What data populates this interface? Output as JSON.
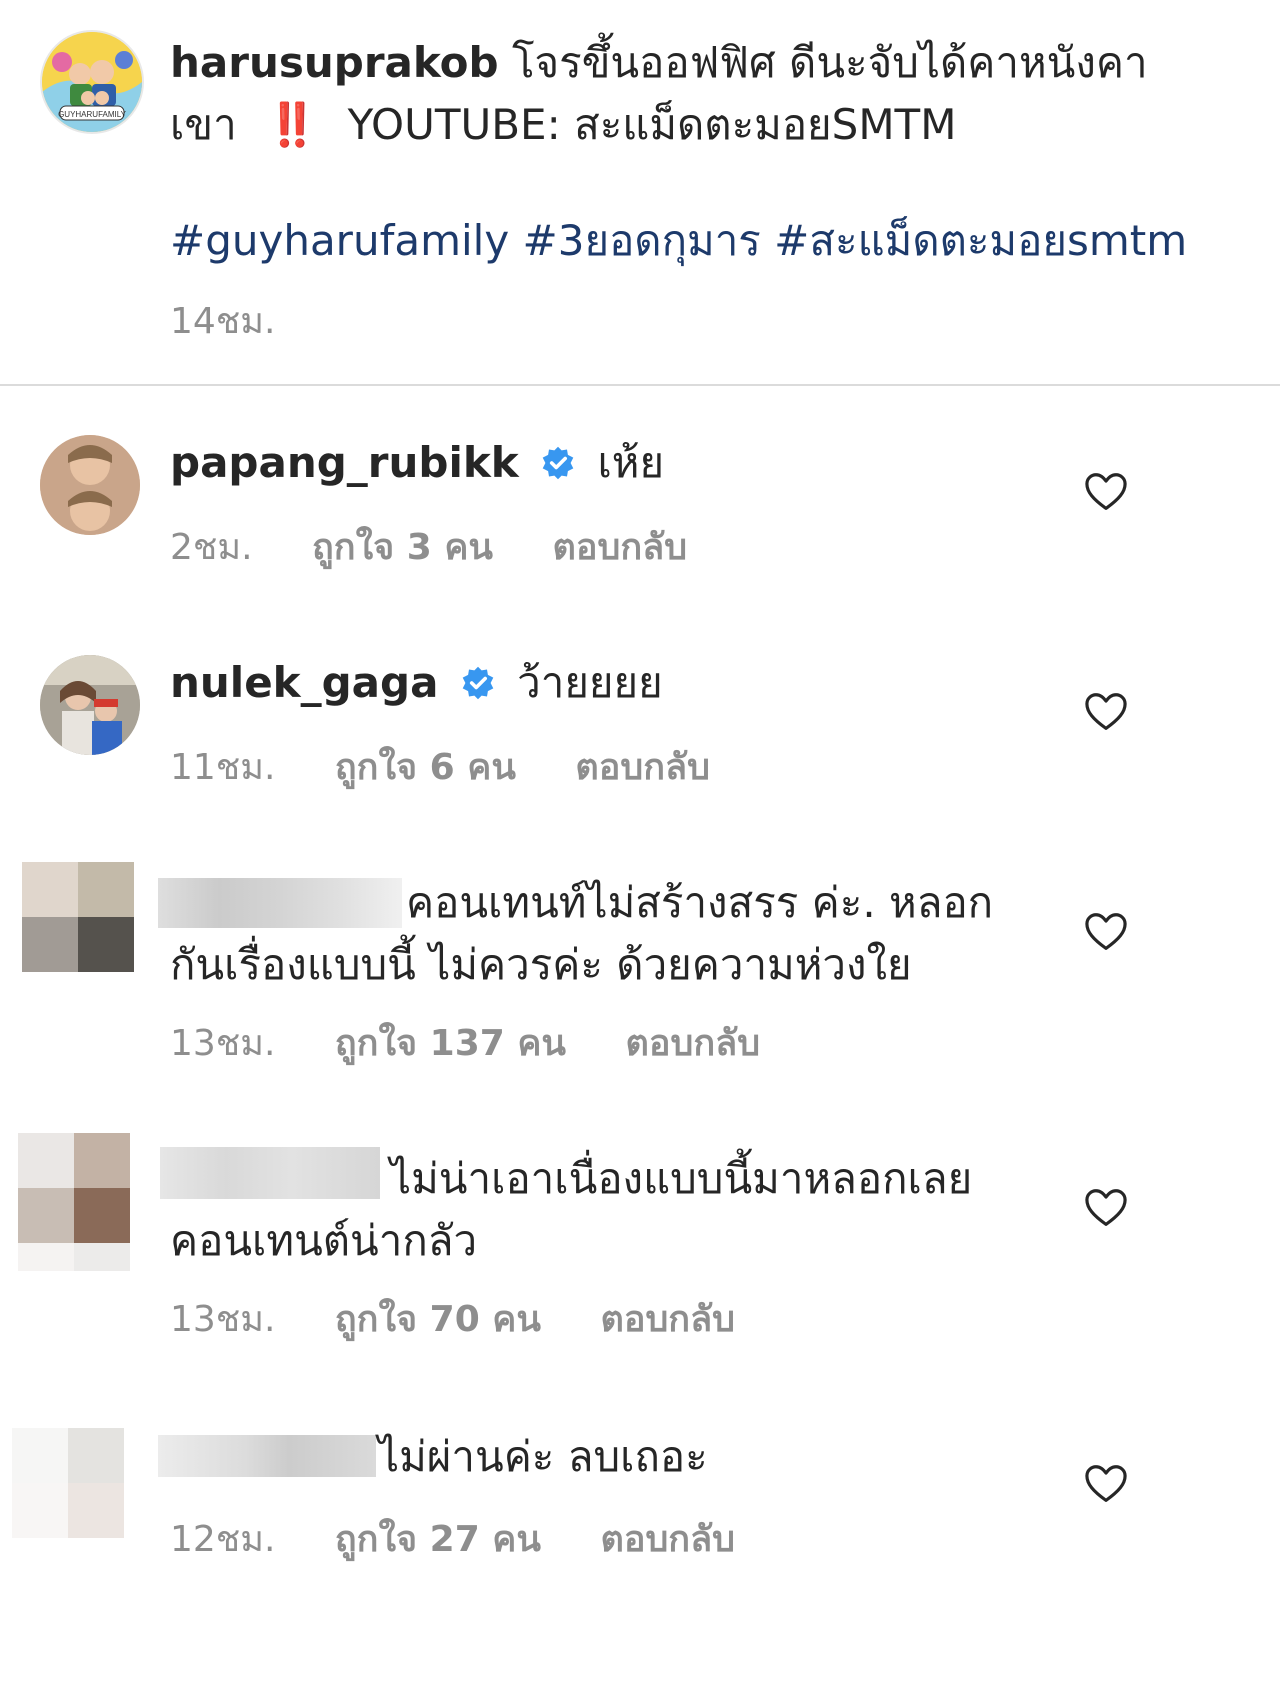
{
  "caption": {
    "username": "harusuprakob",
    "text_line1": "โจรขึ้นออฟฟิศ ดีนะจับได้คาหนังคา",
    "text_line2_a": "เขา",
    "text_line2_emoji": "‼️",
    "text_line2_b": "YOUTUBE: สะแม็ดตะมอยSMTM",
    "hashtags": "#guyharufamily #3ยอดกุมาร #สะแม็ดตะมอยsmtm",
    "time": "14ชม.",
    "avatar_text": "GUYHARUFAMILY"
  },
  "comments": [
    {
      "username": "papang_rubikk",
      "verified": true,
      "text": "เห้ย",
      "time": "2ชม.",
      "likes": "ถูกใจ 3 คน",
      "reply": "ตอบกลับ"
    },
    {
      "username": "nulek_gaga",
      "verified": true,
      "text": "ว้ายยยย",
      "time": "11ชม.",
      "likes": "ถูกใจ 6 คน",
      "reply": "ตอบกลับ"
    },
    {
      "username": "",
      "text_line1": "คอนเทนท์ไม่สร้างสรร ค่ะ.  หลอก",
      "text_line2": "กันเรื่องแบบนี้ ไม่ควรค่ะ  ด้วยความห่วงใย",
      "time": "13ชม.",
      "likes": "ถูกใจ 137 คน",
      "reply": "ตอบกลับ"
    },
    {
      "username": "",
      "text_line1": "ไม่น่าเอาเนื่องแบบนี้มาหลอกเลย",
      "text_line2": "คอนเทนต์น่ากลัว",
      "time": "13ชม.",
      "likes": "ถูกใจ 70 คน",
      "reply": "ตอบกลับ"
    },
    {
      "username": "",
      "text_line1": "ไม่ผ่านค่ะ ลบเถอะ",
      "time": "12ชม.",
      "likes": "ถูกใจ 27 คน",
      "reply": "ตอบกลับ"
    }
  ],
  "colors": {
    "hashtag": "#1d3a6b",
    "verified": "#3897f0",
    "meta": "#8e8e8e",
    "emoji": "#d2301f"
  },
  "icons": {
    "like": "heart-outline-icon",
    "verified": "verified-badge-icon"
  }
}
